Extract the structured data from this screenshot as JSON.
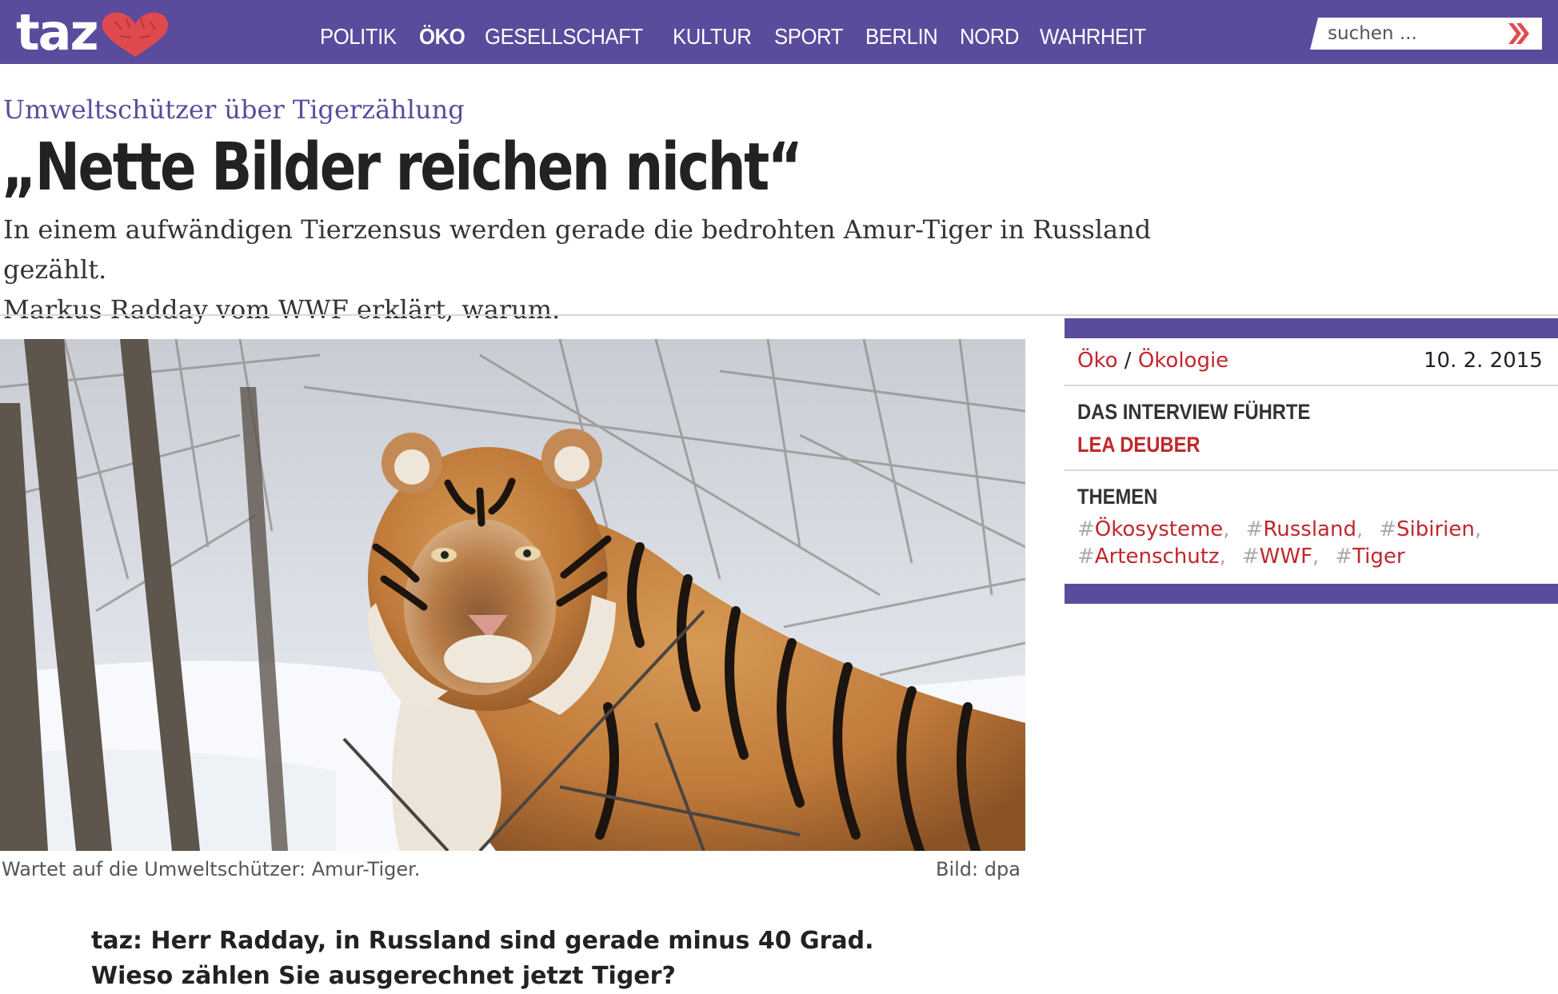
{
  "header": {
    "logo_text": "taz",
    "nav": [
      {
        "label": "POLITIK",
        "active": false
      },
      {
        "label": "ÖKO",
        "active": true
      },
      {
        "label": "GESELLSCHAFT",
        "active": false
      },
      {
        "label": "KULTUR",
        "active": false
      },
      {
        "label": "SPORT",
        "active": false
      },
      {
        "label": "BERLIN",
        "active": false
      },
      {
        "label": "NORD",
        "active": false
      },
      {
        "label": "WAHRHEIT",
        "active": false
      }
    ],
    "search": {
      "placeholder": "suchen ...",
      "button_icon": "double-chevron-right-icon"
    }
  },
  "article": {
    "kicker": "Umweltschützer über Tigerzählung",
    "headline": "„Nette Bilder reichen nicht“",
    "lead_line1": "In einem aufwändigen Tierzensus werden gerade die bedrohten Amur-Tiger in Russland gezählt.",
    "lead_line2": "Markus Radday vom WWF erklärt, warum.",
    "image": {
      "caption": "Wartet auf die Umweltschützer: Amur-Tiger.",
      "credit": "Bild: dpa"
    },
    "question_line1": "taz: Herr Radday, in Russland sind gerade minus 40 Grad.",
    "question_line2": "Wieso zählen Sie ausgerechnet jetzt Tiger?"
  },
  "sidebar": {
    "category": "Öko",
    "separator": "/",
    "subcategory": "Ökologie",
    "date": "10. 2. 2015",
    "interview_heading": "DAS INTERVIEW FÜHRTE",
    "author": "LEA DEUBER",
    "topics_heading": "THEMEN",
    "tags": [
      "Ökosysteme",
      "Russland",
      "Sibirien",
      "Artenschutz",
      "WWF",
      "Tiger"
    ]
  },
  "colors": {
    "brand_purple": "#5a4b9c",
    "link_red": "#c0272d",
    "heart_red": "#e04a4f"
  }
}
